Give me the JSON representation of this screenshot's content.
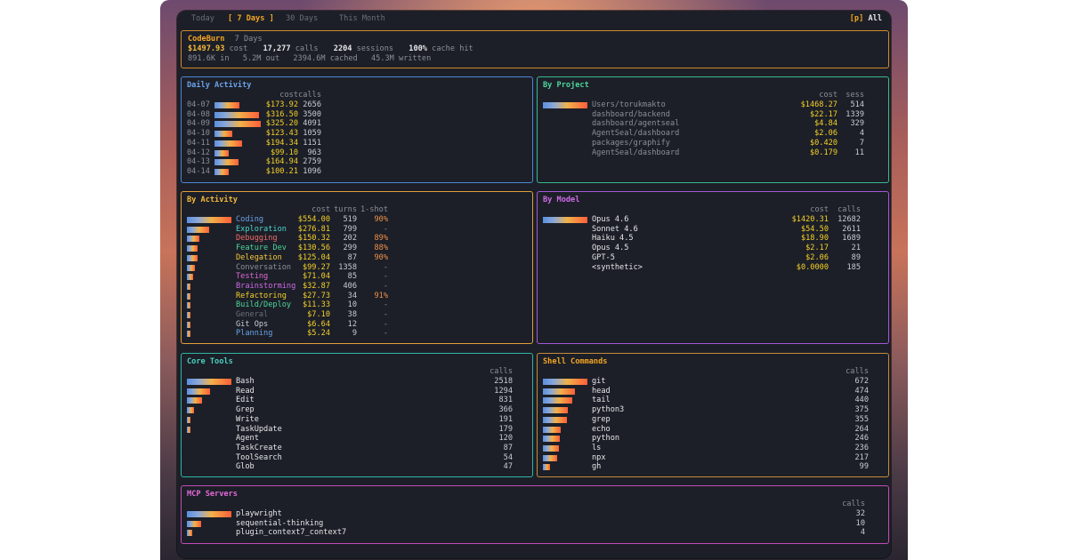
{
  "tabs": [
    "Today",
    "[ 7 Days ]",
    "30 Days",
    "This Month"
  ],
  "active_tab": 1,
  "hint_key": "[p]",
  "hint_label": "All",
  "summary": {
    "app": "CodeBurn",
    "period": "7 Days",
    "cost": "$1497.93",
    "cost_label": "cost",
    "calls": "17,277",
    "calls_label": "calls",
    "sessions": "2204",
    "sessions_label": "sessions",
    "cache": "100%",
    "cache_label": "cache hit",
    "line2": [
      "891.6K in",
      "5.2M out",
      "2394.6M cached",
      "45.3M written"
    ]
  },
  "daily": {
    "title": "Daily Activity",
    "headers": [
      "cost",
      "calls"
    ],
    "rows": [
      {
        "date": "04-07",
        "cost": "$173.92",
        "calls": "2656",
        "frac": 0.53
      },
      {
        "date": "04-08",
        "cost": "$316.50",
        "calls": "3500",
        "frac": 0.97
      },
      {
        "date": "04-09",
        "cost": "$325.20",
        "calls": "4091",
        "frac": 1.0
      },
      {
        "date": "04-10",
        "cost": "$123.43",
        "calls": "1059",
        "frac": 0.38
      },
      {
        "date": "04-11",
        "cost": "$194.34",
        "calls": "1151",
        "frac": 0.6
      },
      {
        "date": "04-12",
        "cost": "$99.10",
        "calls": "963",
        "frac": 0.3
      },
      {
        "date": "04-13",
        "cost": "$164.94",
        "calls": "2759",
        "frac": 0.51
      },
      {
        "date": "04-14",
        "cost": "$100.21",
        "calls": "1096",
        "frac": 0.31
      }
    ]
  },
  "project": {
    "title": "By Project",
    "headers": [
      "cost",
      "sess"
    ],
    "rows": [
      {
        "name": "Users/torukmakto",
        "cost": "$1468.27",
        "sess": "514",
        "frac": 1.0
      },
      {
        "name": "dashboard/backend",
        "cost": "$22.17",
        "sess": "1339",
        "frac": 0
      },
      {
        "name": "dashboard/agentseal",
        "cost": "$4.84",
        "sess": "329",
        "frac": 0
      },
      {
        "name": "AgentSeal/dashboard",
        "cost": "$2.06",
        "sess": "4",
        "frac": 0
      },
      {
        "name": "packages/graphify",
        "cost": "$0.420",
        "sess": "7",
        "frac": 0
      },
      {
        "name": "AgentSeal/dashboard",
        "cost": "$0.179",
        "sess": "11",
        "frac": 0
      }
    ]
  },
  "activity": {
    "title": "By Activity",
    "headers": [
      "cost",
      "turns",
      "1-shot"
    ],
    "rows": [
      {
        "name": "Coding",
        "color": "#6aa2ea",
        "cost": "$554.00",
        "turns": "519",
        "shot": "90%",
        "frac": 1.0
      },
      {
        "name": "Exploration",
        "color": "#4cd6d0",
        "cost": "$276.81",
        "turns": "799",
        "shot": "-",
        "frac": 0.5
      },
      {
        "name": "Debugging",
        "color": "#f06a6a",
        "cost": "$150.32",
        "turns": "202",
        "shot": "89%",
        "frac": 0.27
      },
      {
        "name": "Feature Dev",
        "color": "#4cd69c",
        "cost": "$130.56",
        "turns": "299",
        "shot": "88%",
        "frac": 0.24
      },
      {
        "name": "Delegation",
        "color": "#f5c93a",
        "cost": "$125.04",
        "turns": "87",
        "shot": "90%",
        "frac": 0.23
      },
      {
        "name": "Conversation",
        "color": "#8b8f98",
        "cost": "$99.27",
        "turns": "1358",
        "shot": "-",
        "frac": 0.18
      },
      {
        "name": "Testing",
        "color": "#e06ad8",
        "cost": "$71.04",
        "turns": "85",
        "shot": "-",
        "frac": 0.13
      },
      {
        "name": "Brainstorming",
        "color": "#d06ae8",
        "cost": "$32.87",
        "turns": "406",
        "shot": "-",
        "frac": 0.06
      },
      {
        "name": "Refactoring",
        "color": "#f5d02a",
        "cost": "$27.73",
        "turns": "34",
        "shot": "91%",
        "frac": 0.05
      },
      {
        "name": "Build/Deploy",
        "color": "#4cd69c",
        "cost": "$11.33",
        "turns": "10",
        "shot": "-",
        "frac": 0.02
      },
      {
        "name": "General",
        "color": "#6b6f78",
        "cost": "$7.10",
        "turns": "38",
        "shot": "-",
        "frac": 0.01
      },
      {
        "name": "Git Ops",
        "color": "#c9ccd3",
        "cost": "$6.64",
        "turns": "12",
        "shot": "-",
        "frac": 0.01
      },
      {
        "name": "Planning",
        "color": "#6aa2ea",
        "cost": "$5.24",
        "turns": "9",
        "shot": "-",
        "frac": 0.01
      }
    ]
  },
  "model": {
    "title": "By Model",
    "headers": [
      "cost",
      "calls"
    ],
    "rows": [
      {
        "name": "Opus 4.6",
        "cost": "$1420.31",
        "calls": "12682",
        "frac": 1.0
      },
      {
        "name": "Sonnet 4.6",
        "cost": "$54.50",
        "calls": "2611",
        "frac": 0
      },
      {
        "name": "Haiku 4.5",
        "cost": "$18.90",
        "calls": "1689",
        "frac": 0
      },
      {
        "name": "Opus 4.5",
        "cost": "$2.17",
        "calls": "21",
        "frac": 0
      },
      {
        "name": "GPT-5",
        "cost": "$2.06",
        "calls": "89",
        "frac": 0
      },
      {
        "name": "<synthetic>",
        "cost": "$0.0000",
        "calls": "185",
        "frac": 0
      }
    ]
  },
  "tools": {
    "title": "Core Tools",
    "header": "calls",
    "rows": [
      {
        "name": "Bash",
        "calls": "2518",
        "frac": 1.0
      },
      {
        "name": "Read",
        "calls": "1294",
        "frac": 0.51
      },
      {
        "name": "Edit",
        "calls": "831",
        "frac": 0.33
      },
      {
        "name": "Grep",
        "calls": "366",
        "frac": 0.15
      },
      {
        "name": "Write",
        "calls": "191",
        "frac": 0.08
      },
      {
        "name": "TaskUpdate",
        "calls": "179",
        "frac": 0.07
      },
      {
        "name": "Agent",
        "calls": "120",
        "frac": 0
      },
      {
        "name": "TaskCreate",
        "calls": "87",
        "frac": 0
      },
      {
        "name": "ToolSearch",
        "calls": "54",
        "frac": 0
      },
      {
        "name": "Glob",
        "calls": "47",
        "frac": 0
      }
    ]
  },
  "shell": {
    "title": "Shell Commands",
    "header": "calls",
    "rows": [
      {
        "name": "git",
        "calls": "672",
        "frac": 1.0
      },
      {
        "name": "head",
        "calls": "474",
        "frac": 0.71
      },
      {
        "name": "tail",
        "calls": "440",
        "frac": 0.65
      },
      {
        "name": "python3",
        "calls": "375",
        "frac": 0.56
      },
      {
        "name": "grep",
        "calls": "355",
        "frac": 0.53
      },
      {
        "name": "echo",
        "calls": "264",
        "frac": 0.39
      },
      {
        "name": "python",
        "calls": "246",
        "frac": 0.37
      },
      {
        "name": "ls",
        "calls": "236",
        "frac": 0.35
      },
      {
        "name": "npx",
        "calls": "217",
        "frac": 0.32
      },
      {
        "name": "gh",
        "calls": "99",
        "frac": 0.15
      }
    ]
  },
  "mcp": {
    "title": "MCP Servers",
    "header": "calls",
    "rows": [
      {
        "name": "playwright",
        "calls": "32",
        "frac": 1.0
      },
      {
        "name": "sequential-thinking",
        "calls": "10",
        "frac": 0.31
      },
      {
        "name": "plugin_context7_context7",
        "calls": "4",
        "frac": 0.12
      }
    ]
  }
}
